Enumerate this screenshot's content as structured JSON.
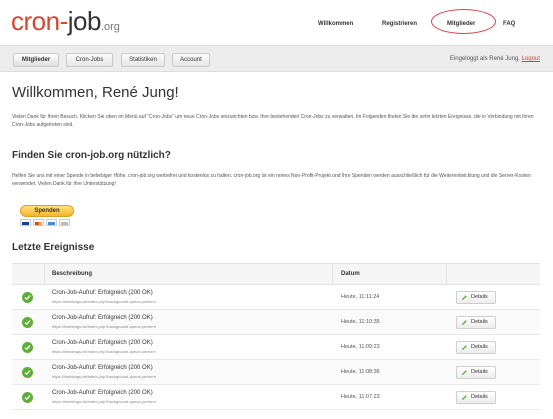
{
  "header": {
    "logo": {
      "part1": "cron-",
      "part2": "job",
      "part3": ".org"
    },
    "nav": [
      {
        "label": "Willkommen"
      },
      {
        "label": "Registrieren"
      },
      {
        "label": "Mitglieder"
      },
      {
        "label": "FAQ"
      }
    ]
  },
  "toolbar": {
    "tabs": [
      {
        "label": "Mitglieder"
      },
      {
        "label": "Cron-Jobs"
      },
      {
        "label": "Statistiken"
      },
      {
        "label": "Account"
      }
    ],
    "logged_in_text": "Eingeloggt als René Jung.",
    "logout_label": "Logout"
  },
  "main": {
    "title": "Willkommen, René Jung!",
    "intro": "Vielen Dank für Ihren Besuch. Klicken Sie oben im Menü auf \"Cron-Jobs\" um neue Cron-Jobs einzurichten bzw. Ihre bestehenden Cron-Jobs zu verwalten. Im Folgenden finden Sie die zehn letzten Ereignisse, die in Verbindung mit Ihren Cron-Jobs aufgetreten sind.",
    "useful_heading": "Finden Sie cron-job.org nützlich?",
    "useful_text": "Helfen Sie uns mit einer Spende in beliebiger Höhe. cron-job.org werbefrei und kostenlos zu halten. cron-job.org ist ein reines Non-Profit-Projekt und Ihre Spenden werden ausschließlich für die Weiterentwicklung und die Server-Kosten verwendet. Vielen Dank für Ihre Unterstützung!",
    "donate_label": "Spenden",
    "events_heading": "Letzte Ereignisse",
    "table": {
      "headers": {
        "description": "Beschreibung",
        "date": "Datum"
      },
      "rows": [
        {
          "status_icon": "check-icon",
          "description": "Cron-Job-Aufruf: Erfolgreich (200 OK)",
          "url": "https://lineblrags.de/index.php?background-queue-perform",
          "date": "Heute, 11:11:24",
          "action": "Details"
        },
        {
          "status_icon": "check-icon",
          "description": "Cron-Job-Aufruf: Erfolgreich (200 OK)",
          "url": "https://lineblrags.de/index.php?background-queue-perform",
          "date": "Heute, 11:10:35",
          "action": "Details"
        },
        {
          "status_icon": "check-icon",
          "description": "Cron-Job-Aufruf: Erfolgreich (200 OK)",
          "url": "https://lineblrags.de/index.php?background-queue-perform",
          "date": "Heute, 11:09:23",
          "action": "Details"
        },
        {
          "status_icon": "check-icon",
          "description": "Cron-Job-Aufruf: Erfolgreich (200 OK)",
          "url": "https://lineblrags.de/index.php?background-queue-perform",
          "date": "Heute, 11:08:36",
          "action": "Details"
        },
        {
          "status_icon": "check-icon",
          "description": "Cron-Job-Aufruf: Erfolgreich (200 OK)",
          "url": "https://lineblrags.de/index.php?background-queue-perform",
          "date": "Heute, 11:07:23",
          "action": "Details"
        }
      ]
    }
  },
  "colors": {
    "brand_red": "#d9442f",
    "success_green": "#5fae3a",
    "donate_yellow": "#f6b52b",
    "highlight_circle": "#e0404a"
  }
}
